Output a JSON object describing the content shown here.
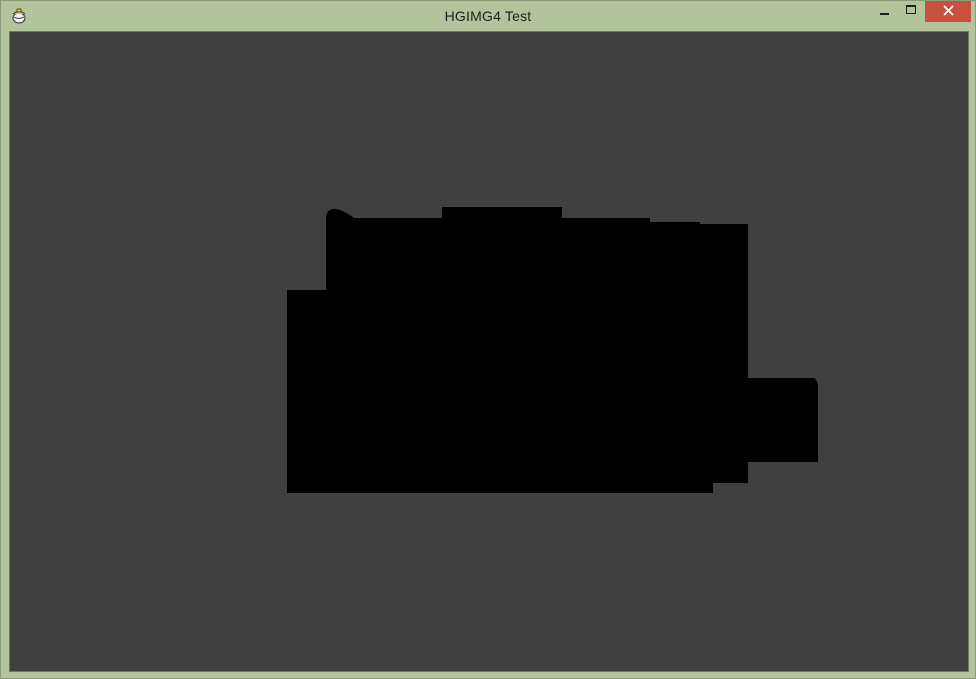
{
  "window": {
    "title": "HGIMG4 Test",
    "app_icon": "teapot-icon",
    "controls": {
      "minimize_icon": "minimize-icon",
      "maximize_icon": "maximize-icon",
      "close_icon": "close-icon"
    }
  },
  "colors": {
    "frame": "#b3c39b",
    "client_background": "#404040",
    "rendered_object": "#000000",
    "close_button": "#c7503f"
  }
}
